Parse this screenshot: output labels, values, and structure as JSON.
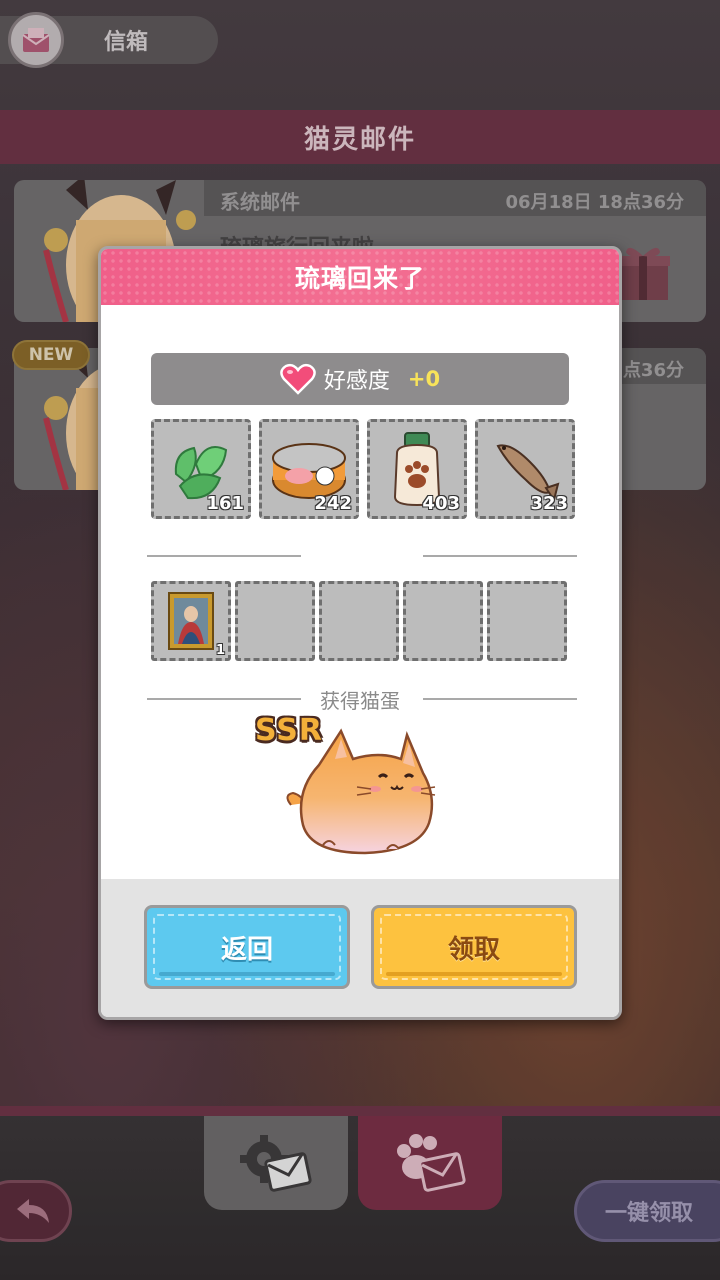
{
  "header": {
    "title": "信箱",
    "icon": "mail-icon"
  },
  "section_title": "猫灵邮件",
  "mails": [
    {
      "tag": "系统邮件",
      "date": "06月18日 18点36分",
      "subject": "琉璃旅行回来啦~",
      "is_new": false
    },
    {
      "tag": "",
      "date": "点36分",
      "subject": "",
      "is_new": true,
      "new_label": "NEW"
    }
  ],
  "dialog": {
    "title": "琉璃回来了",
    "affinity_label": "好感度",
    "affinity_value": "+0",
    "items": [
      {
        "name": "catnip-leaves",
        "count": "161"
      },
      {
        "name": "fish-can",
        "count": "242"
      },
      {
        "name": "paw-jar",
        "count": "403"
      },
      {
        "name": "dried-fish",
        "count": "323"
      }
    ],
    "souvenirs": [
      {
        "name": "painting",
        "count": "1"
      },
      {
        "name": "empty",
        "count": ""
      },
      {
        "name": "empty",
        "count": ""
      },
      {
        "name": "empty",
        "count": ""
      },
      {
        "name": "empty",
        "count": ""
      }
    ],
    "egg_section_title": "获得猫蛋",
    "egg_rarity": "SSR",
    "back_label": "返回",
    "claim_label": "领取"
  },
  "bottom": {
    "collect_all_label": "一键领取",
    "tabs": [
      "system-mail-tab",
      "cat-mail-tab"
    ]
  },
  "colors": {
    "accent_pink": "#f05f89",
    "section_band": "#6e3447",
    "back_button": "#5dc9ef",
    "claim_button": "#fdc23f",
    "affinity_value": "#f8e35a"
  }
}
